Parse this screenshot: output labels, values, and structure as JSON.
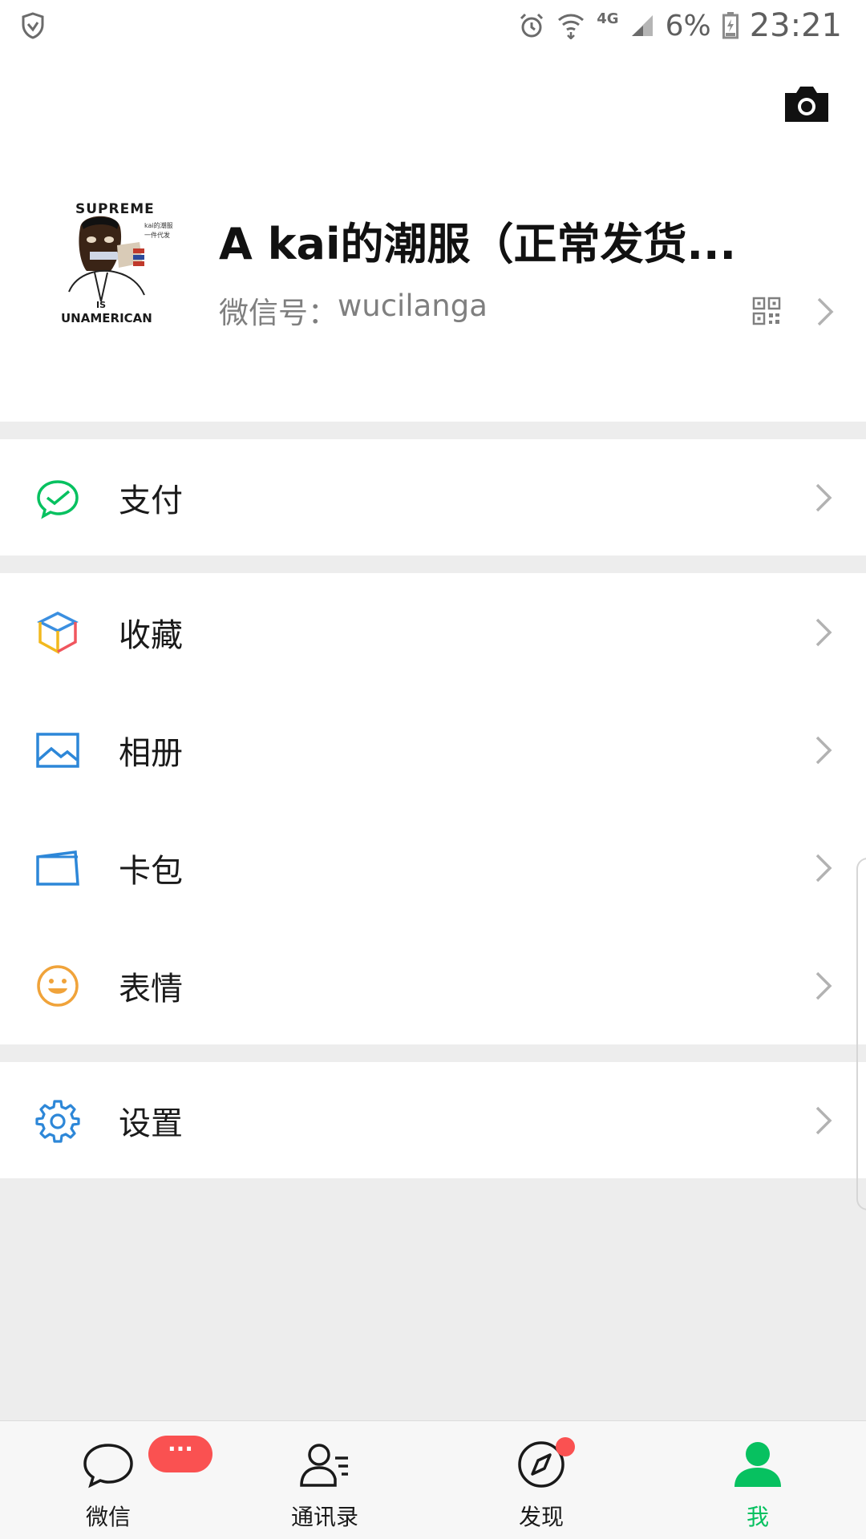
{
  "status_bar": {
    "network": "4G",
    "battery": "6%",
    "time": "23:21"
  },
  "profile": {
    "name": "A  kai的潮服（正常发货...",
    "wechat_id_label": "微信号：",
    "wechat_id": "wucilanga",
    "avatar_text": {
      "top": "SUPREME",
      "side1": "kai的潮服",
      "side2": "一件代发",
      "is": "IS",
      "bottom": "UNAMERICAN"
    }
  },
  "menu": {
    "pay": "支付",
    "favorites": "收藏",
    "album": "相册",
    "cards": "卡包",
    "stickers": "表情",
    "settings": "设置"
  },
  "tabbar": {
    "chats": "微信",
    "contacts": "通讯录",
    "discover": "发现",
    "me": "我",
    "chats_badge": "···"
  },
  "colors": {
    "accent_green": "#07c160",
    "badge_red": "#fa5151"
  }
}
